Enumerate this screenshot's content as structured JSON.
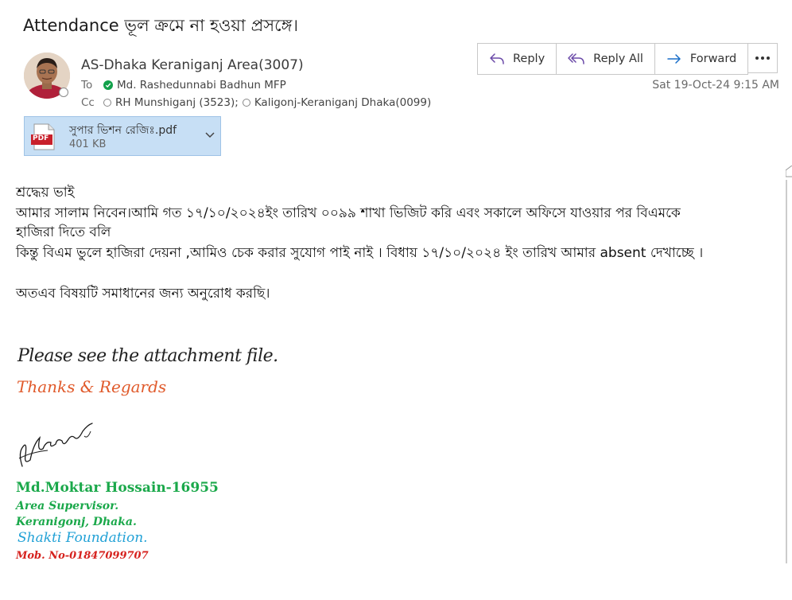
{
  "subject": "Attendance ভূল ক্রমে না হওয়া প্রসঙ্গে।",
  "sender": "AS-Dhaka Keraniganj Area(3007)",
  "to": {
    "label": "To",
    "name": "Md. Rashedunnabi Badhun MFP"
  },
  "cc": {
    "label": "Cc",
    "recipients": [
      "RH Munshiganj (3523);",
      "Kaligonj-Keraniganj Dhaka(0099)"
    ]
  },
  "actions": {
    "reply": "Reply",
    "reply_all": "Reply All",
    "forward": "Forward"
  },
  "date": "Sat 19-Oct-24 9:15 AM",
  "attachment": {
    "name": "সুপার ভিশন রেজিঃ.pdf",
    "size": "401 KB",
    "badge": "PDF"
  },
  "body": {
    "greeting": "শ্রদ্ধেয় ভাই",
    "line1": "আমার সালাম নিবেন।আমি গত ১৭/১০/২০২৪ইং তারিখ ০০৯৯ শাখা ভিজিট করি এবং সকালে অফিসে যাওয়ার পর বিএমকে",
    "line2": "হাজিরা দিতে বলি",
    "line3": "কিন্তু বিএম ভুলে হাজিরা দেয়না ,আমিও চেক করার সুযোগ পাই নাই । বিধায় ১৭/১০/২০২৪ ইং তারিখ আমার absent দেখাচ্ছে ।",
    "line4": "অতএব বিষয়টি সমাধানের জন্য অনুরোধ করছি।"
  },
  "signature": {
    "note": "Please see the attachment file.",
    "thanks": "Thanks & Regards",
    "name": "Md.Moktar Hossain-16955",
    "title": "Area Supervisor.",
    "location": "Keranigonj, Dhaka.",
    "org": "Shakti Foundation.",
    "mobile": "Mob. No-01847099707"
  },
  "icons": [
    "reply-icon",
    "reply-all-icon",
    "forward-icon",
    "more-icon",
    "pdf-icon",
    "chevron-down-icon",
    "presence-icon",
    "check-icon"
  ]
}
